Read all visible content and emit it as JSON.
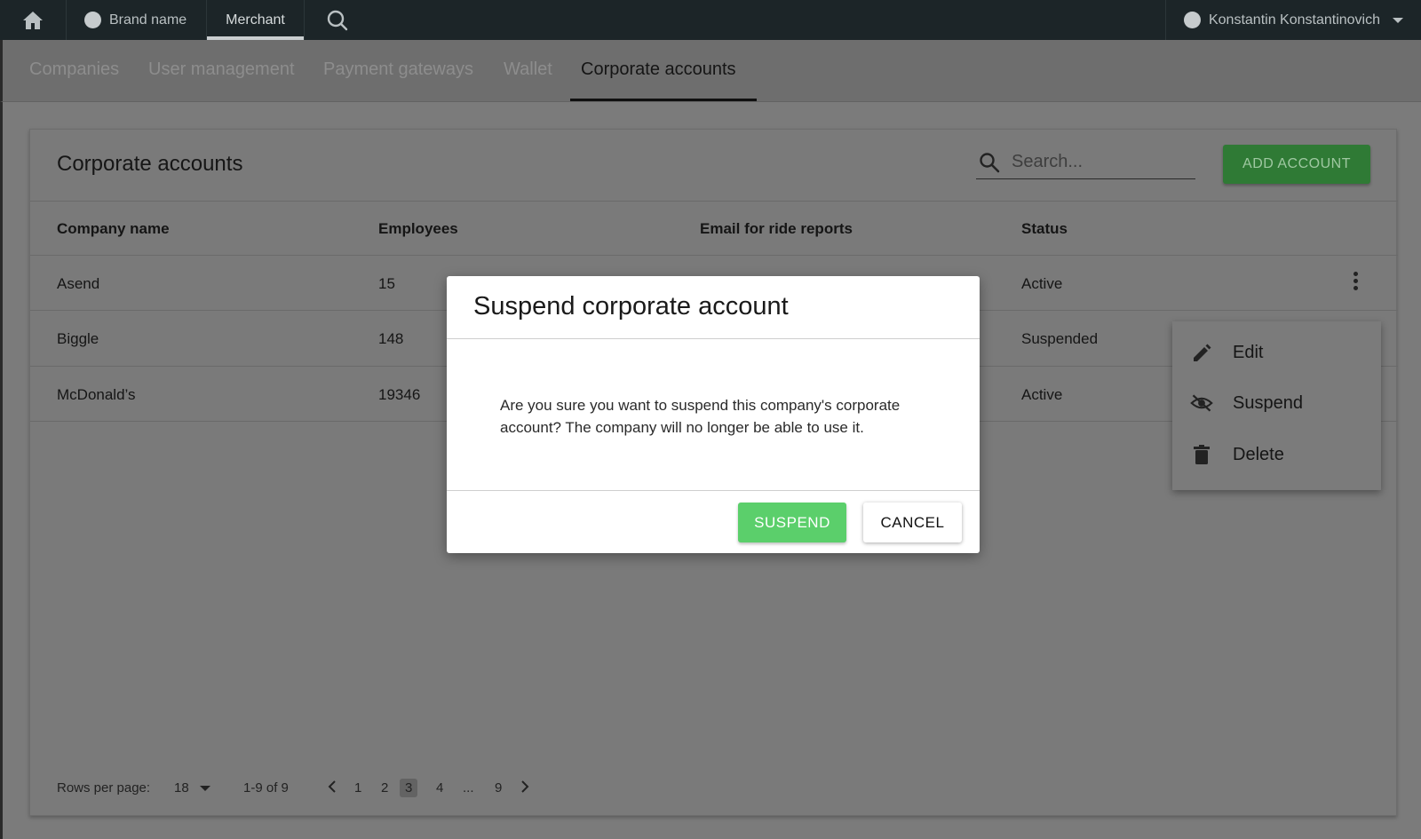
{
  "topbar": {
    "brand": "Brand name",
    "merchant": "Merchant",
    "user": "Konstantin Konstantinovich",
    "icons": {
      "home": "home-icon",
      "search": "search-icon",
      "dropdown": "chevron-down-icon"
    }
  },
  "subnav": {
    "tabs": [
      {
        "label": "Companies",
        "active": false
      },
      {
        "label": "User management",
        "active": false
      },
      {
        "label": "Payment gateways",
        "active": false
      },
      {
        "label": "Wallet",
        "active": false
      },
      {
        "label": "Corporate accounts",
        "active": true
      }
    ]
  },
  "card": {
    "title": "Corporate accounts",
    "search_placeholder": "Search...",
    "add_button": "ADD ACCOUNT",
    "columns": [
      "Company name",
      "Employees",
      "Email for ride reports",
      "Status"
    ],
    "rows": [
      {
        "company": "Asend",
        "employees": "15",
        "email": "",
        "status": "Active"
      },
      {
        "company": "Biggle",
        "employees": "148",
        "email": "",
        "status": "Suspended"
      },
      {
        "company": "McDonald’s",
        "employees": "19346",
        "email": "",
        "status": "Active"
      }
    ],
    "pagination": {
      "rows_per_page_label": "Rows per page:",
      "rows_per_page_value": "18",
      "range": "1-9 of 9",
      "pages": [
        "1",
        "2",
        "3",
        "4",
        "...",
        "9"
      ],
      "current_page": "3"
    }
  },
  "context_menu": {
    "items": [
      {
        "label": "Edit",
        "icon": "pencil-icon"
      },
      {
        "label": "Suspend",
        "icon": "eye-off-icon"
      },
      {
        "label": "Delete",
        "icon": "trash-icon"
      }
    ]
  },
  "modal": {
    "title": "Suspend corporate account",
    "body": "Are you sure you want to suspend this company's corporate account? The company will no longer be able to use it.",
    "confirm": "SUSPEND",
    "cancel": "CANCEL"
  },
  "colors": {
    "topbar": "#1c2528",
    "add_button": "#2f7a35",
    "suspend_button": "#5bcf6b",
    "overlay": "#7b7b7b"
  }
}
